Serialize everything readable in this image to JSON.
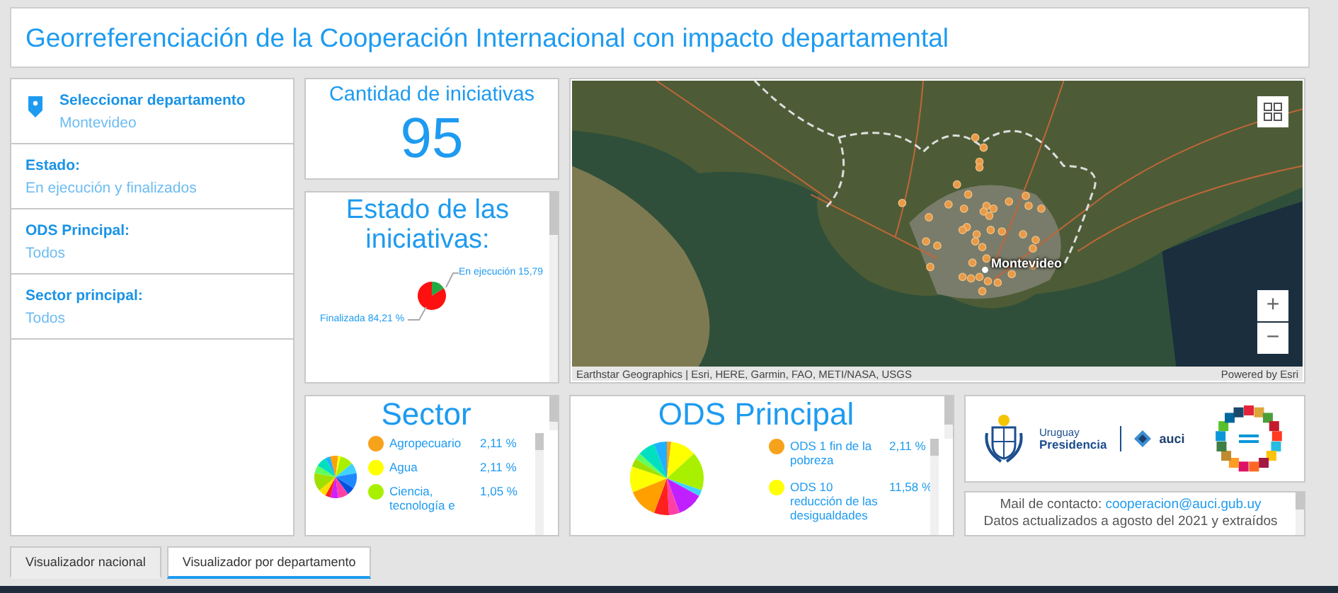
{
  "header": {
    "title": "Georreferenciación de la Cooperación Internacional con impacto departamental"
  },
  "filters": [
    {
      "kind": "select",
      "label": "Seleccionar departamento",
      "value": "Montevideo"
    },
    {
      "kind": "plain",
      "label": "Estado:",
      "value": "En ejecución y finalizados"
    },
    {
      "kind": "plain",
      "label": "ODS Principal:",
      "value": "Todos"
    },
    {
      "kind": "plain",
      "label": "Sector principal:",
      "value": "Todos"
    }
  ],
  "count_card": {
    "title": "Cantidad de iniciativas",
    "value": "95"
  },
  "status_card": {
    "title": "Estado de las iniciativas:",
    "labels": [
      {
        "text": "En ejecución 15,79"
      },
      {
        "text": "Finalizada 84,21 %"
      }
    ]
  },
  "sector_card": {
    "title": "Sector",
    "legend": [
      {
        "name": "Agropecuario",
        "value": "2,11 %",
        "color": "#f7a21b"
      },
      {
        "name": "Agua",
        "value": "2,11 %",
        "color": "#ffff00"
      },
      {
        "name": "Ciencia, tecnología e",
        "value": "1,05 %",
        "color": "#a8f000"
      }
    ]
  },
  "map": {
    "place_label": "Montevideo",
    "attribution": "Earthstar Geographics | Esri, HERE, Garmin, FAO, METI/NASA, USGS",
    "powered_by": "Powered by Esri",
    "zoom_in": "+",
    "zoom_out": "−"
  },
  "ods_card": {
    "title": "ODS Principal",
    "legend": [
      {
        "name": "ODS 1 fin de la pobreza",
        "value": "2,11 %",
        "color": "#f7a21b"
      },
      {
        "name": "ODS 10 reducción de las desigualdades",
        "value": "11,58 %",
        "color": "#ffff00"
      }
    ]
  },
  "logos": {
    "country": "Uruguay",
    "office": "Presidencia",
    "agency": "auci"
  },
  "contact": {
    "label": "Mail de contacto:",
    "email": "cooperacion@auci.gub.uy",
    "note": "Datos actualizados a agosto del 2021 y extraídos"
  },
  "tabs": [
    {
      "label": "Visualizador nacional",
      "selected": false
    },
    {
      "label": "Visualizador por departamento",
      "selected": true
    }
  ]
}
